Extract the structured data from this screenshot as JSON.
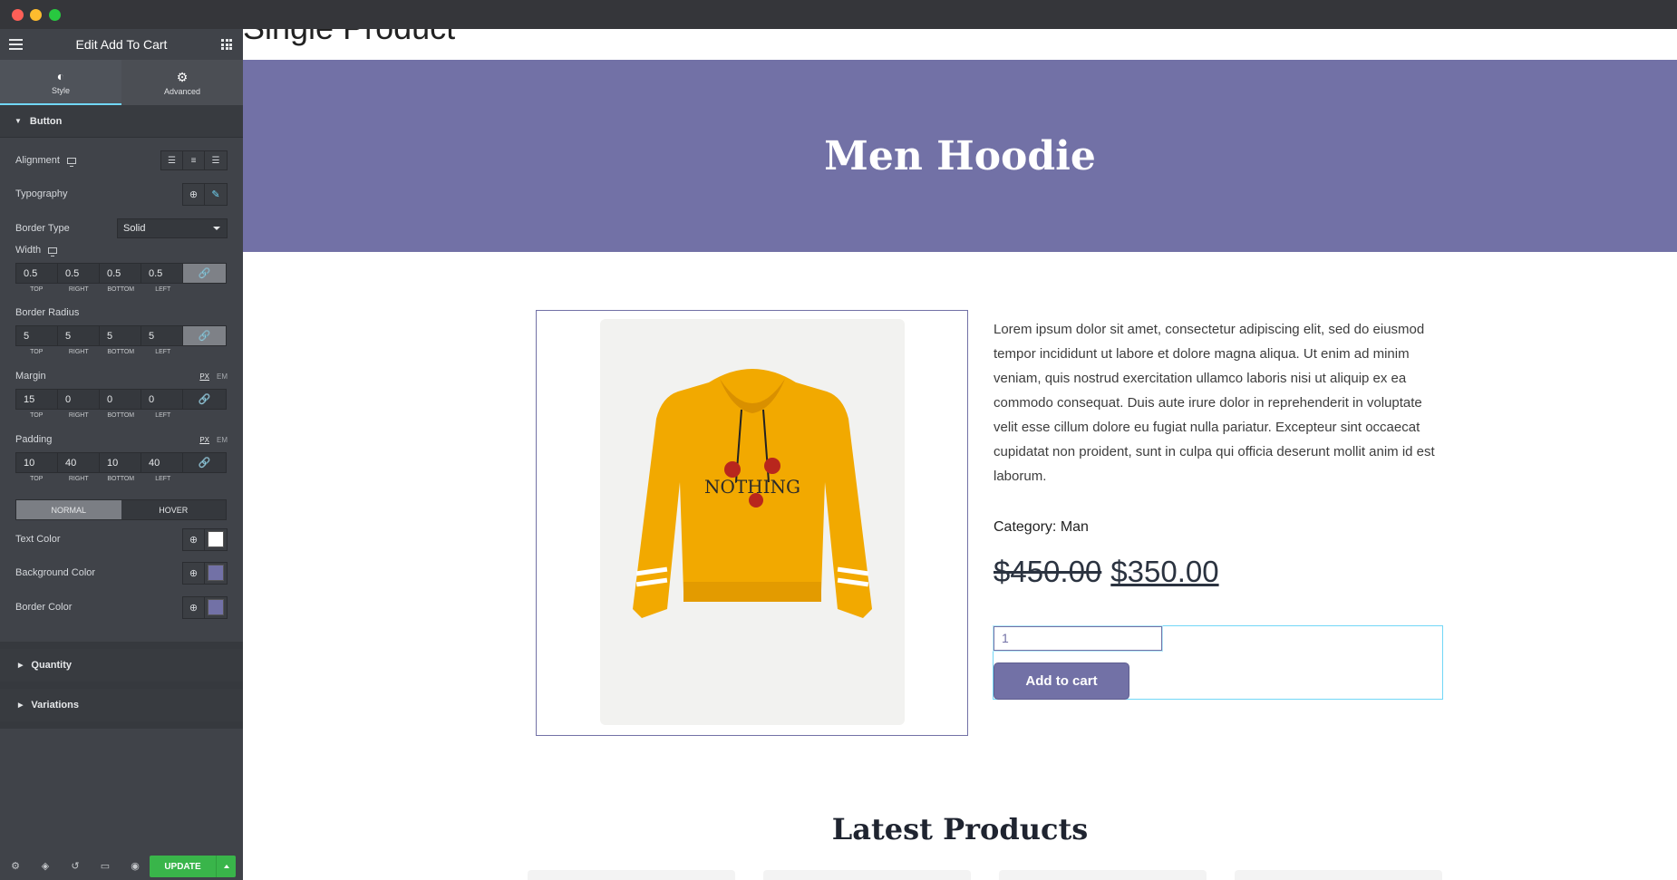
{
  "window": {
    "traffic_lights": [
      "close",
      "minimize",
      "maximize"
    ]
  },
  "sidebar": {
    "title": "Edit Add To Cart",
    "tabs": [
      {
        "label": "Style",
        "icon": "contrast-icon"
      },
      {
        "label": "Advanced",
        "icon": "gear-icon"
      }
    ],
    "section_title": "Button",
    "alignment_label": "Alignment",
    "typography_label": "Typography",
    "border_type_label": "Border Type",
    "border_type_value": "Solid",
    "width": {
      "label": "Width",
      "values": [
        "0.5",
        "0.5",
        "0.5",
        "0.5"
      ]
    },
    "border_radius": {
      "label": "Border Radius",
      "values": [
        "5",
        "5",
        "5",
        "5"
      ]
    },
    "margin": {
      "label": "Margin",
      "values": [
        "15",
        "0",
        "0",
        "0"
      ]
    },
    "padding": {
      "label": "Padding",
      "values": [
        "10",
        "40",
        "10",
        "40"
      ]
    },
    "sides": [
      "TOP",
      "RIGHT",
      "BOTTOM",
      "LEFT"
    ],
    "units": {
      "px": "PX",
      "em": "EM"
    },
    "state_tabs": {
      "normal": "NORMAL",
      "hover": "HOVER"
    },
    "text_color": {
      "label": "Text Color",
      "value": "#ffffff"
    },
    "background_color": {
      "label": "Background Color",
      "value": "#7271a6"
    },
    "border_color": {
      "label": "Border Color",
      "value": "#7271a6"
    },
    "collapsed_sections": [
      "Quantity",
      "Variations"
    ],
    "update_label": "UPDATE"
  },
  "preview": {
    "page_title": "Single Product",
    "hero_title": "Men Hoodie",
    "description": "Lorem ipsum dolor sit amet, consectetur adipiscing elit, sed do eiusmod tempor incididunt ut labore et dolore magna aliqua. Ut enim ad minim veniam, quis nostrud exercitation ullamco laboris nisi ut aliquip ex ea commodo consequat. Duis aute irure dolor in reprehenderit in voluptate velit esse cillum dolore eu fugiat nulla pariatur. Excepteur sint occaecat cupidatat non proident, sunt in culpa qui officia deserunt mollit anim id est laborum.",
    "category": "Category: Man",
    "old_price": "$450.00",
    "new_price": "$350.00",
    "quantity": "1",
    "add_to_cart": "Add to cart",
    "hoodie_print": "NOTHING",
    "latest_products": "Latest Products"
  },
  "colors": {
    "accent": "#7271a6",
    "update": "#39b54a",
    "focus": "#71d7f7"
  }
}
